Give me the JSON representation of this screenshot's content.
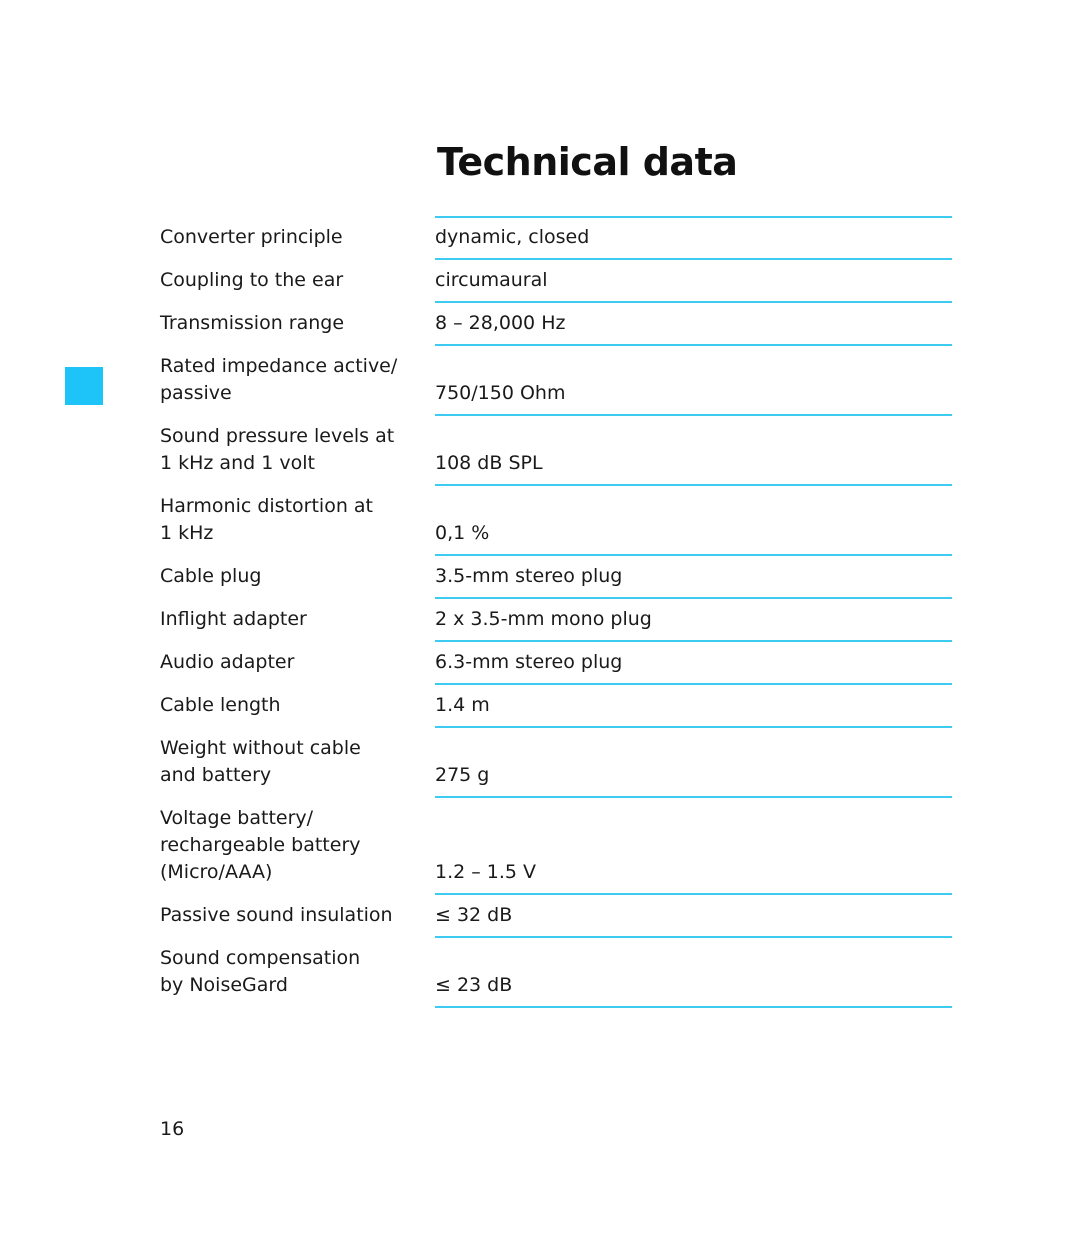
{
  "page": {
    "title": "Technical data",
    "page_number": "16",
    "accent_color": "#1ec3f8",
    "rule_color": "#3ecbf2"
  },
  "specs": [
    {
      "label": "Converter principle",
      "value": "dynamic, closed"
    },
    {
      "label": "Coupling to the ear",
      "value": "circumaural"
    },
    {
      "label": "Transmission range",
      "value": "8 – 28,000 Hz"
    },
    {
      "label": "Rated impedance active/\npassive",
      "value": "750/150 Ohm"
    },
    {
      "label": "Sound pressure levels at\n1 kHz and 1 volt",
      "value": "108 dB SPL"
    },
    {
      "label": "Harmonic distortion at\n1 kHz",
      "value": "0,1 %"
    },
    {
      "label": "Cable plug",
      "value": "3.5-mm stereo plug"
    },
    {
      "label": "Inflight adapter",
      "value": "2 x 3.5-mm mono plug"
    },
    {
      "label": "Audio adapter",
      "value": "6.3-mm stereo plug"
    },
    {
      "label": "Cable length",
      "value": "1.4 m"
    },
    {
      "label": "Weight without cable\nand battery",
      "value": "275 g"
    },
    {
      "label": "Voltage battery/\nrechargeable battery\n(Micro/AAA)",
      "value": "1.2 – 1.5 V"
    },
    {
      "label": "Passive sound insulation",
      "value": "≤ 32 dB"
    },
    {
      "label": "Sound compensation\nby NoiseGard",
      "value": "≤ 23 dB"
    }
  ]
}
